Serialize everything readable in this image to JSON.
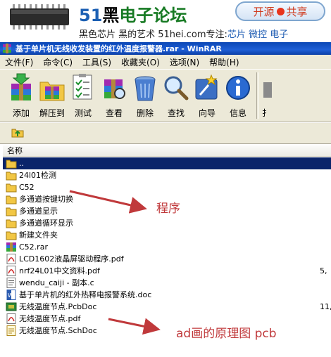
{
  "banner": {
    "logo_51": "51",
    "logo_hei": "黑",
    "logo_rest": "电子论坛",
    "share_left": "开源",
    "share_right": "共享",
    "slogan_main": "黑色芯片 黑的艺术 51hei.com专注:",
    "slogan_blue": "芯片 微控 电子"
  },
  "window": {
    "title": "基于单片机无线收发装置的红外温度报警器.rar - WinRAR"
  },
  "menu": {
    "items": [
      "文件(F)",
      "命令(C)",
      "工具(S)",
      "收藏夹(O)",
      "选项(N)",
      "帮助(H)"
    ]
  },
  "toolbar": {
    "buttons": [
      {
        "label": "添加",
        "icon": "add-icon"
      },
      {
        "label": "解压到",
        "icon": "extract-to-icon"
      },
      {
        "label": "测试",
        "icon": "test-icon"
      },
      {
        "label": "查看",
        "icon": "view-icon"
      },
      {
        "label": "删除",
        "icon": "delete-icon"
      },
      {
        "label": "查找",
        "icon": "find-icon"
      },
      {
        "label": "向导",
        "icon": "wizard-icon"
      },
      {
        "label": "信息",
        "icon": "info-icon"
      },
      {
        "label": "扌",
        "icon": "repair-icon"
      }
    ]
  },
  "list": {
    "column_name": "名称",
    "files": [
      {
        "name": "..",
        "size": "",
        "icon": "parent-folder-icon"
      },
      {
        "name": "24l01检测",
        "size": "",
        "icon": "folder-icon"
      },
      {
        "name": "C52",
        "size": "",
        "icon": "folder-icon"
      },
      {
        "name": "多通道按键切换",
        "size": "",
        "icon": "folder-icon"
      },
      {
        "name": "多通道显示",
        "size": "",
        "icon": "folder-icon"
      },
      {
        "name": "多通道循环显示",
        "size": "",
        "icon": "folder-icon"
      },
      {
        "name": "新建文件夹",
        "size": "",
        "icon": "folder-icon"
      },
      {
        "name": "C52.rar",
        "size": "",
        "icon": "rar-icon"
      },
      {
        "name": "LCD1602液晶屏驱动程序.pdf",
        "size": "",
        "icon": "pdf-icon"
      },
      {
        "name": "nrf24L01中文资料.pdf",
        "size": "5,",
        "icon": "pdf-icon"
      },
      {
        "name": "wendu_caiji - 副本.c",
        "size": "",
        "icon": "c-file-icon"
      },
      {
        "name": "基于单片机的红外热释电报警系统.doc",
        "size": "",
        "icon": "doc-icon"
      },
      {
        "name": "无线温度节点.PcbDoc",
        "size": "11,",
        "icon": "pcb-icon"
      },
      {
        "name": "无线温度节点.pdf",
        "size": "",
        "icon": "pdf-icon"
      },
      {
        "name": "无线温度节点.SchDoc",
        "size": "",
        "icon": "sch-icon"
      }
    ]
  },
  "annotations": {
    "program": "程序",
    "ad_note": "ad画的原理图 pcb"
  },
  "colors": {
    "titlebar": "#0a47b6",
    "selection": "#0a246a",
    "annotation": "#c0393b",
    "chrome": "#ece9d8"
  }
}
